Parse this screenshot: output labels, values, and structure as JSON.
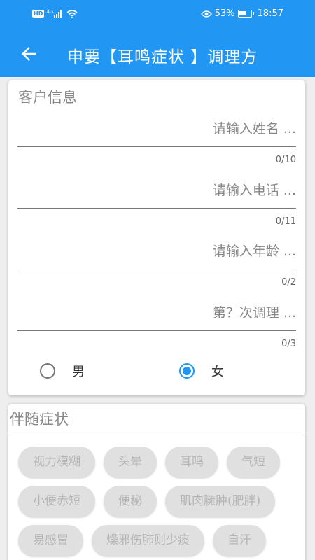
{
  "status_bar": {
    "hd": "HD",
    "network": "4G",
    "battery_percent": "53%",
    "time": "18:57"
  },
  "app_bar": {
    "title": "申要【耳鸣症状 】调理方",
    "back_icon": "arrow-back-icon"
  },
  "customer_info": {
    "section_title": "客户信息",
    "fields": [
      {
        "placeholder": "请输入姓名 ...",
        "value": "",
        "counter": "0/10"
      },
      {
        "placeholder": "请输入电话 ...",
        "value": "",
        "counter": "0/11"
      },
      {
        "placeholder": "请输入年龄 ...",
        "value": "",
        "counter": "0/2"
      },
      {
        "placeholder": "第？次调理 ...",
        "value": "",
        "counter": "0/3"
      }
    ],
    "gender": {
      "options": [
        "男",
        "女"
      ],
      "selected": "女"
    }
  },
  "symptoms": {
    "section_title": "伴随症状",
    "chips": [
      "视力模糊",
      "头晕",
      "耳鸣",
      "气短",
      "小便赤短",
      "便秘",
      "肌肉臃肿(肥胖)",
      "易感冒",
      "燥邪伤肺则少痰",
      "自汗"
    ]
  },
  "colors": {
    "primary": "#2196f3",
    "chip_bg": "#e0e0e0",
    "chip_text": "#b5b5b5"
  }
}
